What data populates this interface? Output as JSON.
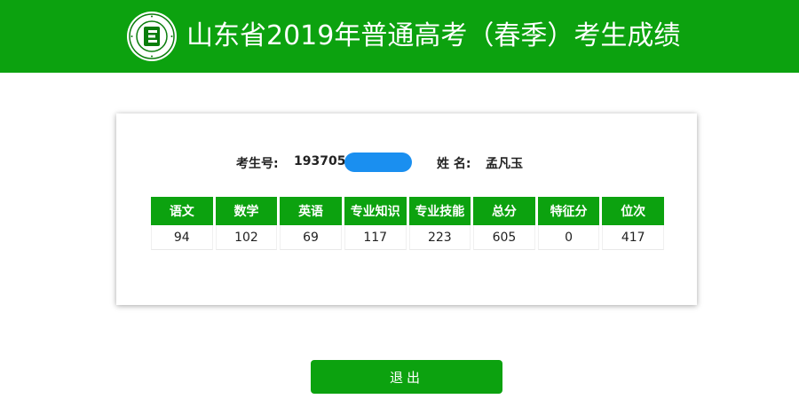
{
  "header": {
    "title": "山东省2019年普通高考（春季）考生成绩",
    "logo_icon": "school-emblem-icon",
    "bg_color": "#0ca20f"
  },
  "candidate": {
    "id_label": "考生号:",
    "id_value": "193705",
    "name_label": "姓 名:",
    "name_value": "孟凡玉"
  },
  "scores": {
    "headers": [
      "语文",
      "数学",
      "英语",
      "专业知识",
      "专业技能",
      "总分",
      "特征分",
      "位次"
    ],
    "values": [
      "94",
      "102",
      "69",
      "117",
      "223",
      "605",
      "0",
      "417"
    ]
  },
  "actions": {
    "exit_label": "退出"
  }
}
